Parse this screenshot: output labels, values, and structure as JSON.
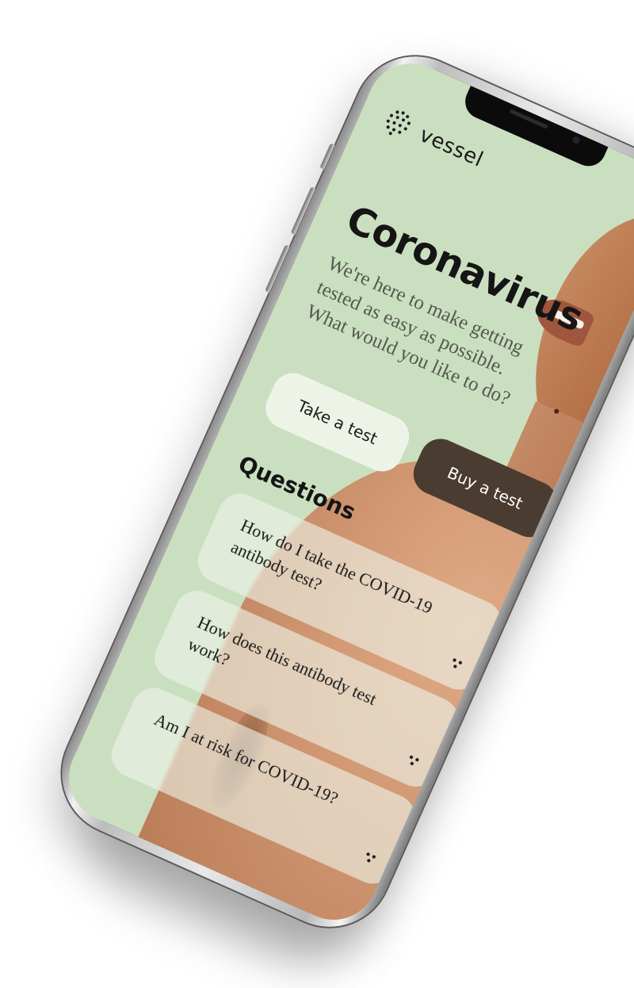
{
  "app": {
    "brand": "vessel"
  },
  "hero": {
    "title": "Coronavirus",
    "subtitle": "We're here to make getting tested as easy as possible. What would you like to do?"
  },
  "actions": {
    "take_test_label": "Take a test",
    "buy_test_label": "Buy a test"
  },
  "questions": {
    "heading": "Questions",
    "items": [
      {
        "label": "How do I take the COVID-19 antibody test?"
      },
      {
        "label": "How does this antibody test work?"
      },
      {
        "label": "Am I at risk for COVID-19?"
      }
    ]
  },
  "icons": {
    "logo": "dotted-circle-icon",
    "question_action": "dots-icon"
  },
  "colors": {
    "screen_background": "#cadfc0",
    "primary_button": "#4a3c30",
    "secondary_button": "#eef3e8",
    "text": "#151515"
  }
}
